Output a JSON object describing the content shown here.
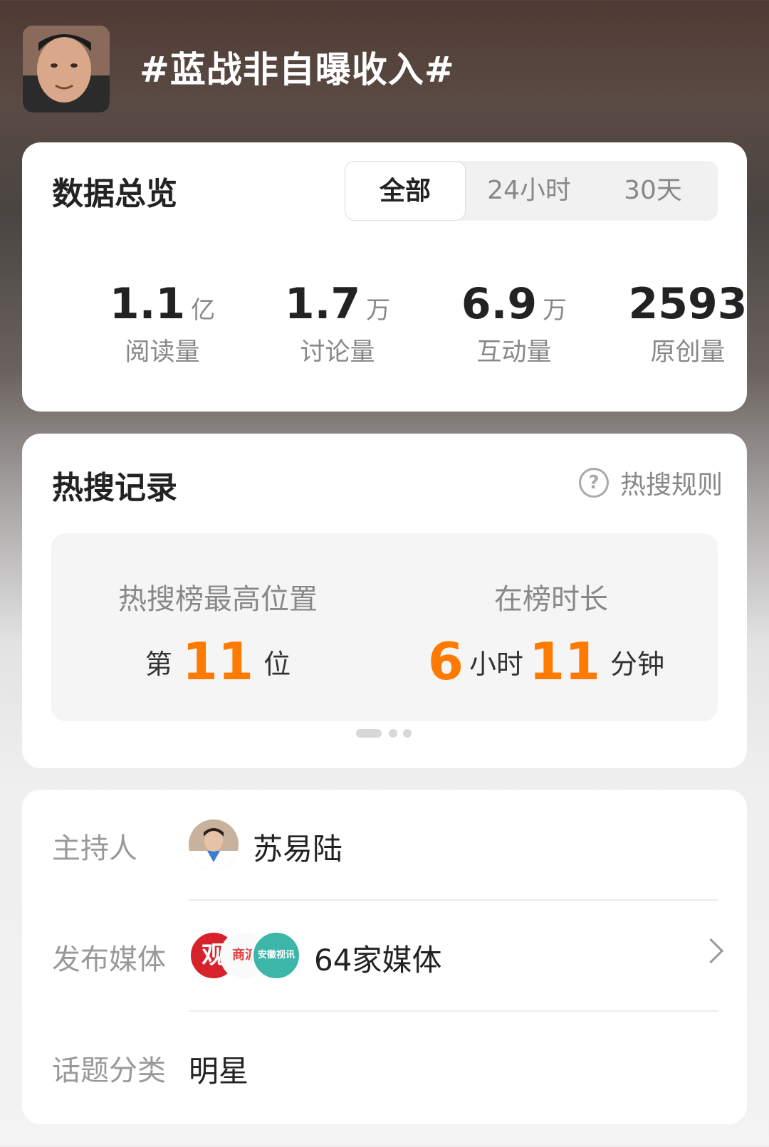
{
  "header": {
    "topic_title": "#蓝战非自曝收入#"
  },
  "overview": {
    "title": "数据总览",
    "tabs": [
      {
        "label": "全部",
        "active": true
      },
      {
        "label": "24小时",
        "active": false
      },
      {
        "label": "30天",
        "active": false
      }
    ],
    "stats": [
      {
        "value": "1.1",
        "unit": "亿",
        "label": "阅读量"
      },
      {
        "value": "1.7",
        "unit": "万",
        "label": "讨论量"
      },
      {
        "value": "6.9",
        "unit": "万",
        "label": "互动量"
      },
      {
        "value": "2593",
        "unit": "",
        "label": "原创量"
      }
    ]
  },
  "hot_search": {
    "title": "热搜记录",
    "rules_link": "热搜规则",
    "help_icon": "question-circle-icon",
    "highest_position": {
      "label": "热搜榜最高位置",
      "prefix": "第",
      "value": "11",
      "suffix": "位"
    },
    "duration": {
      "label": "在榜时长",
      "hours": "6",
      "hours_unit": "小时",
      "minutes": "11",
      "minutes_unit": "分钟"
    },
    "page_indicator": {
      "pages": 3,
      "current": 1
    }
  },
  "info": {
    "host": {
      "label": "主持人",
      "name": "苏易陆"
    },
    "media": {
      "label": "发布媒体",
      "logos": [
        {
          "text": "观",
          "color": "#d8222b"
        },
        {
          "text": "商派",
          "color": "#e23b3b"
        },
        {
          "text": "安徽视讯",
          "color": "#3bb6a9"
        }
      ],
      "count_text": "64家媒体"
    },
    "category": {
      "label": "话题分类",
      "value": "明星"
    }
  },
  "colors": {
    "accent": "#ff7a00",
    "card_bg": "#ffffff"
  }
}
